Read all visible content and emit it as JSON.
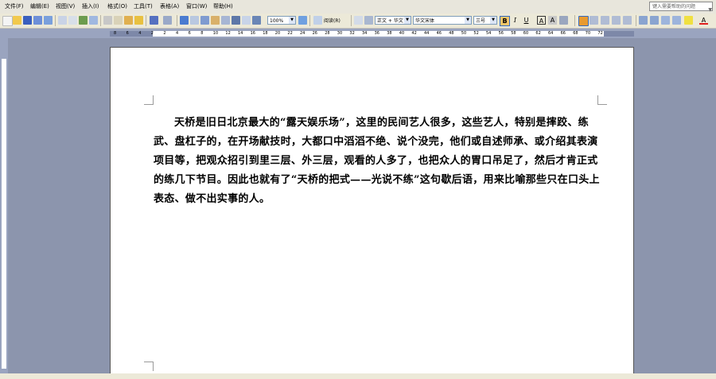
{
  "menu": [
    "文件(F)",
    "编辑(E)",
    "视图(V)",
    "插入(I)",
    "格式(O)",
    "工具(T)",
    "表格(A)",
    "窗口(W)",
    "帮助(H)"
  ],
  "help_box": "键入需要帮助的问题",
  "toolbar": {
    "zoom": "100%",
    "read_label": "阅读(R)",
    "style": "正文 + 华文",
    "font": "华文宋体",
    "size": "三号",
    "bold": "B",
    "italic": "I",
    "underline": "U",
    "char_border": "A",
    "char_shade": "A",
    "font_color": "A"
  },
  "ruler_numbers": [
    "8",
    "6",
    "4",
    "2",
    "2",
    "4",
    "6",
    "8",
    "10",
    "12",
    "14",
    "16",
    "18",
    "20",
    "22",
    "24",
    "26",
    "28",
    "30",
    "32",
    "34",
    "36",
    "38",
    "40",
    "42",
    "44",
    "46",
    "48",
    "50",
    "52",
    "54",
    "56",
    "58",
    "60",
    "62",
    "64",
    "66",
    "68",
    "70",
    "72"
  ],
  "document": {
    "paragraph": "天桥是旧日北京最大的“露天娱乐场”，这里的民间艺人很多，这些艺人，特别是摔跤、练武、盘杠子的，在开场献技时，大都口中滔滔不绝、说个没完，他们或自述师承、或介绍其表演项目等，把观众招引到里三层、外三层，观看的人多了，也把众人的胃口吊足了，然后才肯正式的练几下节目。因此也就有了“天桥的把式——光说不练”这句歇后语，用来比喻那些只在口头上表态、做不出实事的人。"
  },
  "colors": {
    "accent": "#316ac5",
    "background": "#8c95ad",
    "toolbar": "#ece9d8"
  }
}
